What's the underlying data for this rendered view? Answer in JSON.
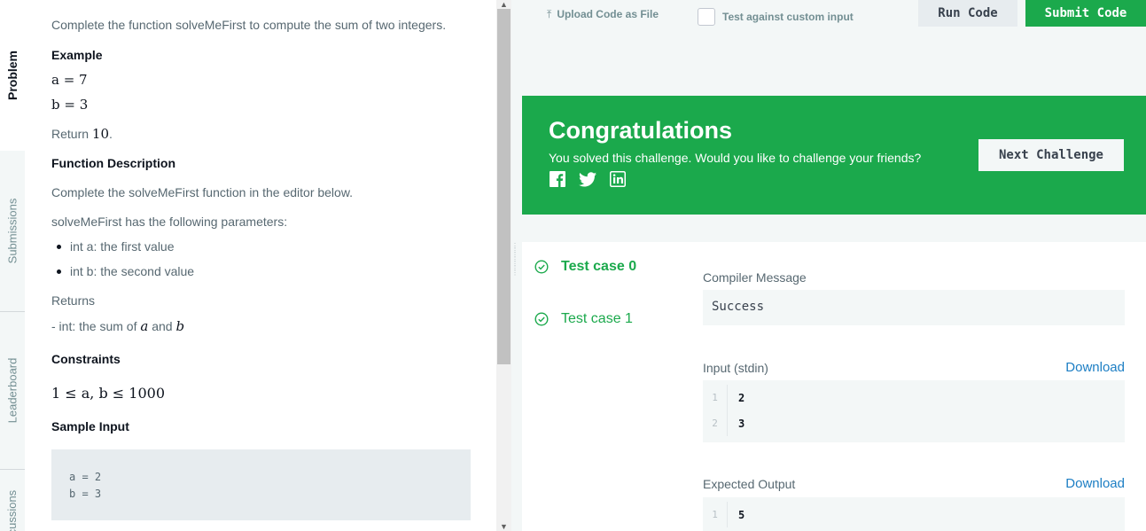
{
  "tabs": {
    "problem": "Problem",
    "submissions": "Submissions",
    "leaderboard": "Leaderboard",
    "discussions": "Discussions"
  },
  "problem": {
    "intro": "Complete the function solveMeFirst to compute the sum of two integers.",
    "example_heading": "Example",
    "example_a": "a = 7",
    "example_b": "b = 3",
    "return_prefix": "Return ",
    "return_value": "10",
    "return_suffix": ".",
    "function_heading": "Function Description",
    "function_text": "Complete the solveMeFirst function in the editor below.",
    "params_text": "solveMeFirst has the following parameters:",
    "params": [
      "int a: the first value",
      "int b: the second value"
    ],
    "returns_heading": "Returns",
    "returns_prefix": "- int: the sum of ",
    "returns_a": "a",
    "returns_and": " and ",
    "returns_b": "b",
    "constraints_heading": "Constraints",
    "constraint": "1 ≤ a, b ≤ 1000",
    "sample_heading": "Sample Input",
    "sample_lines": [
      "a = 2",
      "b = 3"
    ]
  },
  "toolbar": {
    "upload_label": "Upload Code as File",
    "custom_input_label": "Test against custom input",
    "run_label": "Run Code",
    "submit_label": "Submit Code"
  },
  "congrats": {
    "title": "Congratulations",
    "text": "You solved this challenge. Would you like to challenge your friends?",
    "next_label": "Next Challenge",
    "social": [
      "facebook-icon",
      "twitter-icon",
      "linkedin-icon"
    ]
  },
  "results": {
    "test_cases": [
      "Test case 0",
      "Test case 1"
    ],
    "compiler_label": "Compiler Message",
    "compiler_message": "Success",
    "input_label": "Input (stdin)",
    "download_label": "Download",
    "input_lines": [
      {
        "n": "1",
        "v": "2"
      },
      {
        "n": "2",
        "v": "3"
      }
    ],
    "expected_label": "Expected Output",
    "expected_lines": [
      {
        "n": "1",
        "v": "5"
      }
    ]
  },
  "colors": {
    "accent_green": "#1ba94c",
    "link_blue": "#1c7ec4"
  }
}
